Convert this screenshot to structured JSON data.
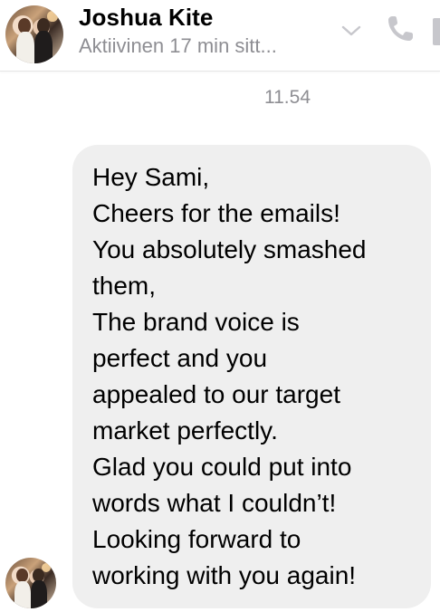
{
  "header": {
    "name": "Joshua Kite",
    "status": "Aktiivinen 17 min sitt..."
  },
  "conversation": {
    "timestamp": "11.54",
    "message_lines": [
      "Hey Sami,",
      "Cheers for the emails!",
      "You absolutely smashed",
      "them,",
      "The brand voice is",
      "perfect and you",
      "appealed to our target",
      "market perfectly.",
      "Glad you could put into",
      "words what I couldn’t!",
      "Looking forward to",
      "working with you again!"
    ]
  },
  "icons": {
    "chevron": "chevron-down-icon",
    "phone": "phone-icon"
  },
  "colors": {
    "bubble_background": "#efefef",
    "icon_gray": "#c7c7cc",
    "secondary_text": "#8e8e93"
  }
}
